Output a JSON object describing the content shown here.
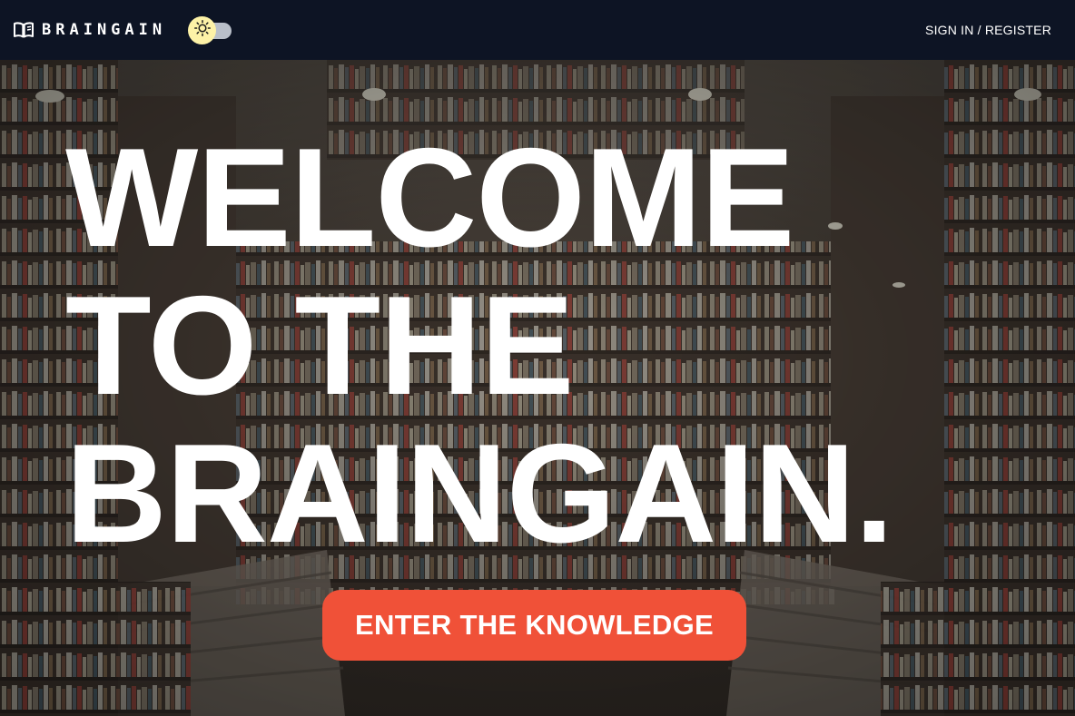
{
  "navbar": {
    "brand_name": "BRAINGAIN",
    "brand_icon": "open-book-icon",
    "theme_toggle_icon": "sun-icon",
    "auth_link": "SIGN IN / REGISTER"
  },
  "hero": {
    "title_lines": [
      "WELCOME",
      "TO THE",
      "BRAINGAIN."
    ],
    "cta_label": "ENTER THE KNOWLEDGE"
  },
  "colors": {
    "navbar_bg": "#0d1424",
    "cta_bg": "#f05138",
    "toggle_knob": "#fdf2a7"
  }
}
